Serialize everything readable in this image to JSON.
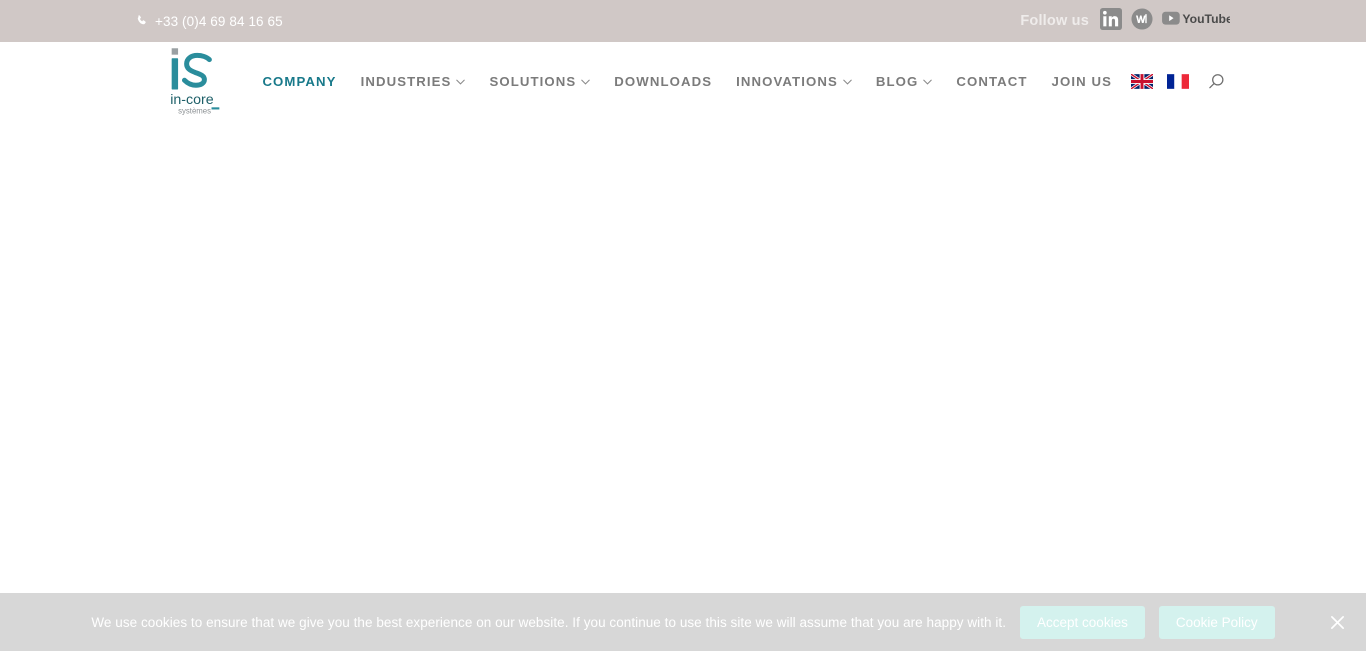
{
  "colors": {
    "topbar_bg": "#d0c8c6",
    "nav_active": "#18798a",
    "nav_text": "#7b7b7b",
    "cookie_bg": "#d7d7d7",
    "cookie_button_bg": "#d4f2ee",
    "logo_teal": "#2a8d9c"
  },
  "topbar": {
    "phone_icon": "phone-icon",
    "phone": "+33 (0)4 69 84 16 65",
    "follow_label": "Follow us",
    "social": [
      {
        "name": "linkedin-icon",
        "label": "LinkedIn"
      },
      {
        "name": "welcome-to-the-jungle-icon",
        "label": "Welcome to the Jungle"
      },
      {
        "name": "youtube-icon",
        "label": "YouTube"
      }
    ]
  },
  "logo": {
    "mark": "iS",
    "name": "in-core",
    "tagline": "systèmes"
  },
  "nav": {
    "items": [
      {
        "label": "COMPANY",
        "active": true,
        "has_dropdown": false
      },
      {
        "label": "INDUSTRIES",
        "active": false,
        "has_dropdown": true
      },
      {
        "label": "SOLUTIONS",
        "active": false,
        "has_dropdown": true
      },
      {
        "label": "DOWNLOADS",
        "active": false,
        "has_dropdown": false
      },
      {
        "label": "INNOVATIONS",
        "active": false,
        "has_dropdown": true
      },
      {
        "label": "BLOG",
        "active": false,
        "has_dropdown": true
      },
      {
        "label": "CONTACT",
        "active": false,
        "has_dropdown": false
      },
      {
        "label": "JOIN US",
        "active": false,
        "has_dropdown": false
      }
    ],
    "languages": [
      {
        "name": "flag-en",
        "label": "English"
      },
      {
        "name": "flag-fr",
        "label": "Français"
      }
    ],
    "search_icon": "search-icon"
  },
  "cookie": {
    "message": "We use cookies to ensure that we give you the best experience on our website. If you continue to use this site we will assume that you are happy with it.",
    "accept_label": "Accept cookies",
    "policy_label": "Cookie Policy",
    "close_icon": "close-icon"
  }
}
